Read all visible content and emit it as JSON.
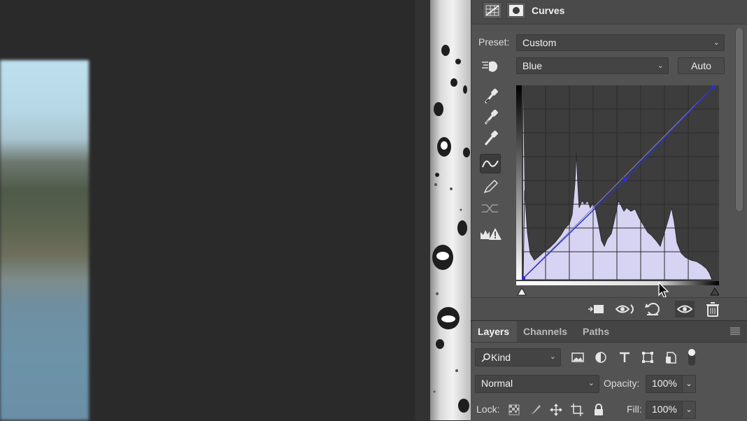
{
  "properties": {
    "title": "Curves",
    "preset_label": "Preset:",
    "preset_value": "Custom",
    "channel_value": "Blue",
    "auto_label": "Auto",
    "tools": [
      "hand-targeted-adjustment-icon",
      "black-point-eyedropper-icon",
      "gray-point-eyedropper-icon",
      "white-point-eyedropper-icon",
      "curve-points-icon",
      "pencil-icon",
      "smooth-curve-icon",
      "clipping-warning-icon"
    ],
    "footer_icons": [
      "clip-to-layer-icon",
      "view-previous-state-icon",
      "reset-adjustments-icon",
      "toggle-visibility-icon",
      "delete-layer-icon"
    ]
  },
  "layers": {
    "tabs": [
      "Layers",
      "Channels",
      "Paths"
    ],
    "kind_label": "Kind",
    "blend_mode": "Normal",
    "opacity_label": "Opacity:",
    "opacity_value": "100%",
    "lock_label": "Lock:",
    "fill_label": "Fill:",
    "fill_value": "100%"
  },
  "colors": {
    "panel": "#535353",
    "curve": "#2f2fd0",
    "histogram_fill": "#d7d3f2"
  }
}
